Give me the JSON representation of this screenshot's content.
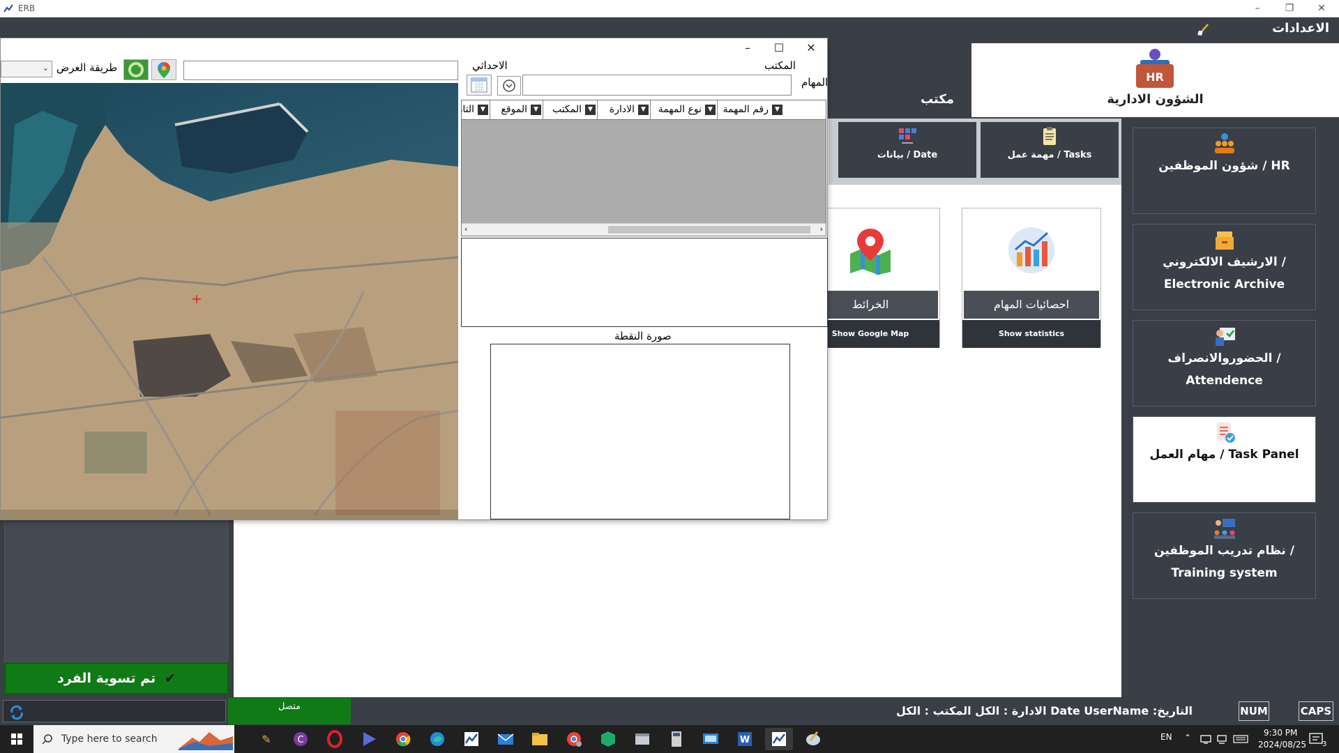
{
  "window": {
    "title": "ERB"
  },
  "menu": {
    "settings_label": "الاعدادات"
  },
  "header": {
    "hr_label": "الشؤون الادارية",
    "office_label": "مكتب"
  },
  "subnav": {
    "tasks_label": "مهمة عمل / Tasks",
    "data_label": "بيانات / Date"
  },
  "right_menu": {
    "items": [
      {
        "label": "شؤون الموظفين / HR",
        "icon": "people-gear-icon"
      },
      {
        "label": "الارشيف الالكتروني / Electronic Archive",
        "icon": "archive-icon"
      },
      {
        "label": "الحضوروالانصراف / Attendence",
        "icon": "attendance-icon"
      },
      {
        "label": "مهام العمل / Task Panel",
        "icon": "task-panel-icon"
      },
      {
        "label": "نظام تدريب الموظفين / Training system",
        "icon": "training-icon"
      }
    ]
  },
  "tiles": {
    "statistics": {
      "name": "احصائيات المهام",
      "sub": "Show statistics"
    },
    "maps": {
      "name": "الخرائط",
      "sub": "Show Google Map"
    }
  },
  "dialog": {
    "view_mode_label": "طريقة العرض",
    "office_label": "المكتب",
    "coords_label": "الاحداثي",
    "tasks_label": "المهام",
    "grid_columns": [
      "رقم المهمة",
      "نوع المهمة",
      "الادارة",
      "المكتب",
      "الموقع",
      "التاريخ"
    ],
    "point_image_label": "صورة النقطة",
    "map_search_value": "",
    "task_input_value": "",
    "map_select_value": ""
  },
  "bottom": {
    "settled_label": "تم تسوية الفرد",
    "connected_label": "متصل",
    "status_text": "التاريخ: Date  UserName  الادارة : الكل المكتب : الكل",
    "num_label": "NUM",
    "caps_label": "CAPS"
  },
  "taskbar": {
    "search_placeholder": "Type here to search",
    "lang": "EN",
    "time": "9:30 PM",
    "date": "2024/08/25",
    "notifications": "3"
  },
  "colors": {
    "dark": "#3a3f47",
    "green": "#107a16",
    "grid_gray": "#acacac"
  }
}
